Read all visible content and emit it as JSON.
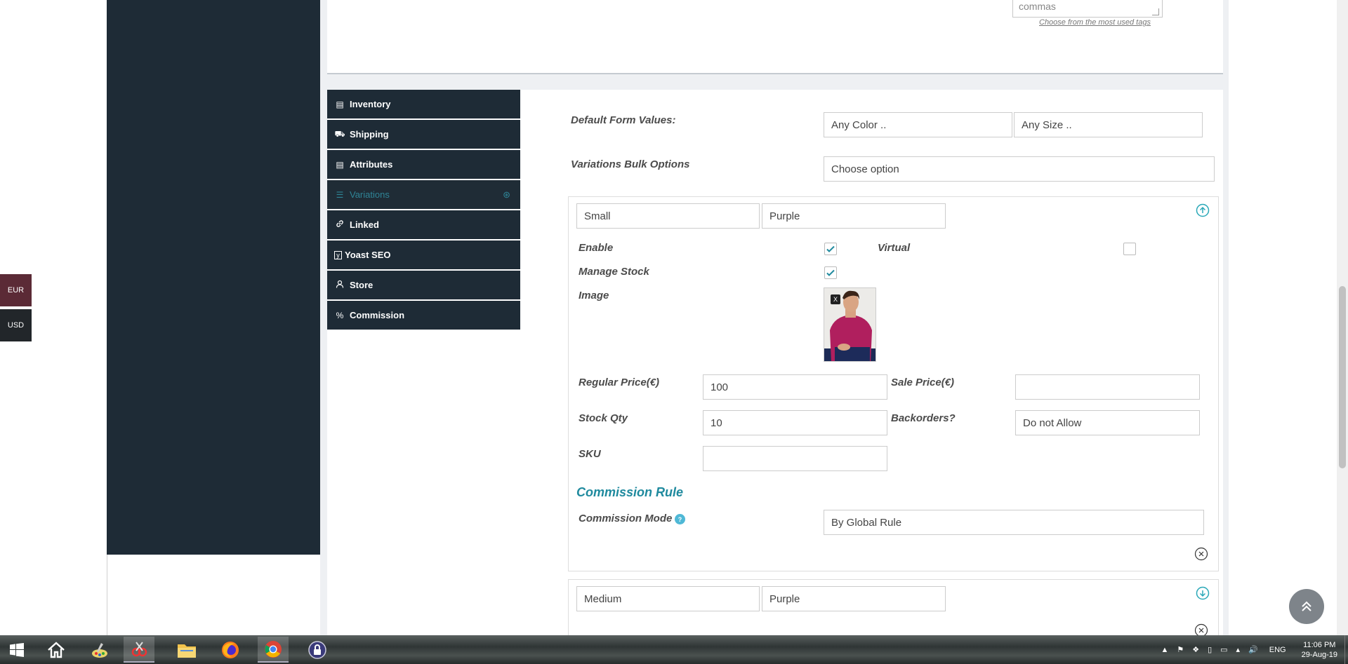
{
  "currency": {
    "eur": "EUR",
    "usd": "USD"
  },
  "tags": {
    "field_text": "commas",
    "link": "Choose from the most used tags"
  },
  "tabs": [
    {
      "label": "Inventory",
      "icon": "database-icon",
      "glyph": "▤"
    },
    {
      "label": "Shipping",
      "icon": "truck-icon",
      "glyph": "⛟"
    },
    {
      "label": "Attributes",
      "icon": "list-icon",
      "glyph": "▤"
    },
    {
      "label": "Variations",
      "icon": "list-ul-icon",
      "glyph": "☰",
      "active": true
    },
    {
      "label": "Linked",
      "icon": "link-icon",
      "glyph": "🔗"
    },
    {
      "label": "Yoast SEO",
      "icon": "yoast-icon",
      "glyph": "ⓨ"
    },
    {
      "label": "Store",
      "icon": "user-icon",
      "glyph": "👤"
    },
    {
      "label": "Commission",
      "icon": "percent-icon",
      "glyph": "%"
    }
  ],
  "form": {
    "default_values_label": "Default Form Values:",
    "color_select": "Any Color ..",
    "size_select": "Any Size ..",
    "bulk_label": "Variations Bulk Options",
    "bulk_select": "Choose option"
  },
  "variation1": {
    "size": "Small",
    "color": "Purple",
    "enable_label": "Enable",
    "enable_checked": true,
    "virtual_label": "Virtual",
    "virtual_checked": false,
    "manage_stock_label": "Manage Stock",
    "manage_stock_checked": true,
    "image_label": "Image",
    "image_remove": "X",
    "regular_price_label": "Regular Price(€)",
    "regular_price": "100",
    "sale_price_label": "Sale Price(€)",
    "sale_price": "",
    "stock_qty_label": "Stock Qty",
    "stock_qty": "10",
    "backorders_label": "Backorders?",
    "backorders": "Do not Allow",
    "sku_label": "SKU",
    "sku": "",
    "commission_title": "Commission Rule",
    "commission_mode_label": "Commission Mode",
    "commission_mode": "By Global Rule"
  },
  "variation2": {
    "size": "Medium",
    "color": "Purple"
  },
  "taskbar": {
    "language": "ENG",
    "time": "11:06 PM",
    "date": "29-Aug-19"
  },
  "colors": {
    "accent": "#1f8a9e",
    "dark": "#1e2b36"
  }
}
